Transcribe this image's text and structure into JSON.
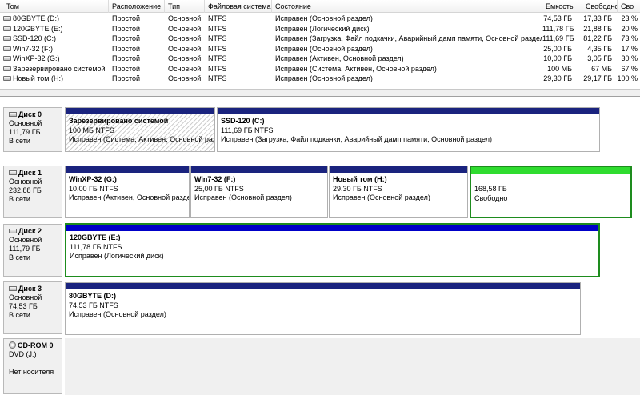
{
  "volume_list": {
    "columns": [
      "Том",
      "Расположение",
      "Тип",
      "Файловая система",
      "Состояние",
      "Емкость",
      "Свободно",
      "Сво"
    ],
    "rows": [
      {
        "volume": "80GBYTE (D:)",
        "layout": "Простой",
        "type": "Основной",
        "fs": "NTFS",
        "status": "Исправен (Основной раздел)",
        "capacity": "74,53 ГБ",
        "free": "17,33 ГБ",
        "pct": "23 %"
      },
      {
        "volume": "120GBYTE (E:)",
        "layout": "Простой",
        "type": "Основной",
        "fs": "NTFS",
        "status": "Исправен (Логический диск)",
        "capacity": "111,78 ГБ",
        "free": "21,88 ГБ",
        "pct": "20 %"
      },
      {
        "volume": "SSD-120 (C:)",
        "layout": "Простой",
        "type": "Основной",
        "fs": "NTFS",
        "status": "Исправен (Загрузка, Файл подкачки, Аварийный дамп памяти, Основной раздел)",
        "capacity": "111,69 ГБ",
        "free": "81,22 ГБ",
        "pct": "73 %"
      },
      {
        "volume": "Win7-32 (F:)",
        "layout": "Простой",
        "type": "Основной",
        "fs": "NTFS",
        "status": "Исправен (Основной раздел)",
        "capacity": "25,00 ГБ",
        "free": "4,35 ГБ",
        "pct": "17 %"
      },
      {
        "volume": "WinXP-32 (G:)",
        "layout": "Простой",
        "type": "Основной",
        "fs": "NTFS",
        "status": "Исправен (Активен, Основной раздел)",
        "capacity": "10,00 ГБ",
        "free": "3,05 ГБ",
        "pct": "30 %"
      },
      {
        "volume": "Зарезервировано системой",
        "layout": "Простой",
        "type": "Основной",
        "fs": "NTFS",
        "status": "Исправен (Система, Активен, Основной раздел)",
        "capacity": "100 МБ",
        "free": "67 МБ",
        "pct": "67 %"
      },
      {
        "volume": "Новый том (H:)",
        "layout": "Простой",
        "type": "Основной",
        "fs": "NTFS",
        "status": "Исправен (Основной раздел)",
        "capacity": "29,30 ГБ",
        "free": "29,17 ГБ",
        "pct": "100 %"
      }
    ]
  },
  "disks": [
    {
      "title": "Диск 0",
      "type": "Основной",
      "size": "111,79 ГБ",
      "state": "В сети",
      "partitions": [
        {
          "name": "Зарезервировано системой",
          "size": "100 МБ NTFS",
          "status": "Исправен (Система, Активен, Основной раздел)"
        },
        {
          "name": "SSD-120  (C:)",
          "size": "111,69 ГБ NTFS",
          "status": "Исправен (Загрузка, Файл подкачки, Аварийный дамп памяти, Основной раздел)"
        }
      ]
    },
    {
      "title": "Диск 1",
      "type": "Основной",
      "size": "232,88 ГБ",
      "state": "В сети",
      "partitions": [
        {
          "name": "WinXP-32  (G:)",
          "size": "10,00 ГБ NTFS",
          "status": "Исправен (Активен, Основной раздел)"
        },
        {
          "name": "Win7-32  (F:)",
          "size": "25,00 ГБ NTFS",
          "status": "Исправен (Основной раздел)"
        },
        {
          "name": "Новый том  (H:)",
          "size": "29,30 ГБ NTFS",
          "status": "Исправен (Основной раздел)"
        },
        {
          "name": "",
          "size": "168,58 ГБ",
          "status": "Свободно"
        }
      ]
    },
    {
      "title": "Диск 2",
      "type": "Основной",
      "size": "111,79 ГБ",
      "state": "В сети",
      "partitions": [
        {
          "name": "120GBYTE  (E:)",
          "size": "111,78 ГБ NTFS",
          "status": "Исправен (Логический диск)"
        }
      ]
    },
    {
      "title": "Диск 3",
      "type": "Основной",
      "size": "74,53 ГБ",
      "state": "В сети",
      "partitions": [
        {
          "name": "80GBYTE  (D:)",
          "size": "74,53 ГБ NTFS",
          "status": "Исправен (Основной раздел)"
        }
      ]
    }
  ],
  "cdrom": {
    "title": "CD-ROM 0",
    "type": "DVD (J:)",
    "state": "Нет носителя"
  },
  "colors": {
    "primary_partition": "#1a237e",
    "logical_drive": "#0000c8",
    "free_space": "#2fdc2f",
    "selection": "#1e8c1e"
  }
}
